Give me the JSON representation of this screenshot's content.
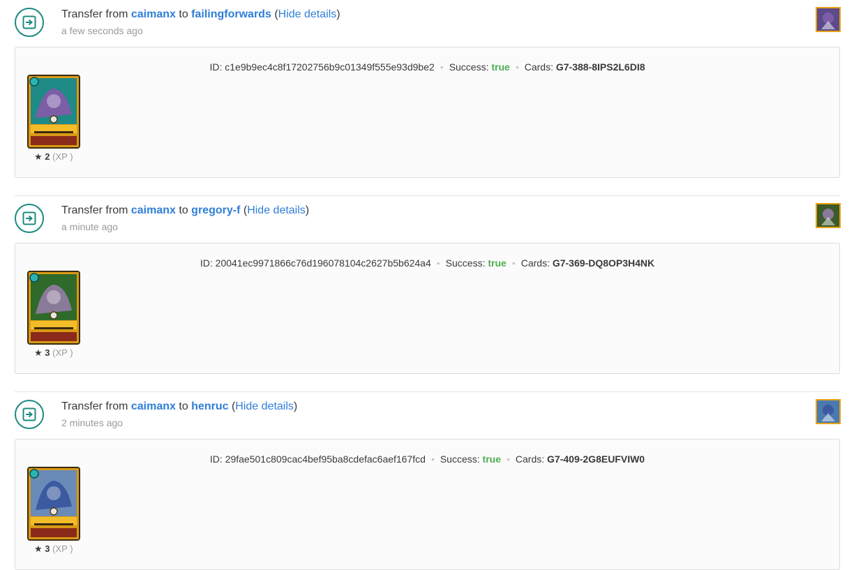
{
  "transfers": [
    {
      "prefix": "Transfer from",
      "from": "caimanx",
      "to_word": "to",
      "to": "failingforwards",
      "details_toggle": "Hide details",
      "time": "a few seconds ago",
      "id_label": "ID:",
      "id": "c1e9b9ec4c8f17202756b9c01349f555e93d9be2",
      "success_label": "Success:",
      "success": "true",
      "cards_label": "Cards:",
      "card_uid": "G7-388-8IPS2L6DI8",
      "level": "2",
      "xp_label": "(XP )",
      "theme": {
        "bg": "#1f8a86",
        "accent": "#7b5ea6",
        "thumb_bg": "#5c4a8a"
      }
    },
    {
      "prefix": "Transfer from",
      "from": "caimanx",
      "to_word": "to",
      "to": "gregory-f",
      "details_toggle": "Hide details",
      "time": "a minute ago",
      "id_label": "ID:",
      "id": "20041ec9971866c76d196078104c2627b5b624a4",
      "success_label": "Success:",
      "success": "true",
      "cards_label": "Cards:",
      "card_uid": "G7-369-DQ8OP3H4NK",
      "level": "3",
      "xp_label": "(XP )",
      "theme": {
        "bg": "#2f6a2a",
        "accent": "#8a7a9a",
        "thumb_bg": "#3d5a2a"
      }
    },
    {
      "prefix": "Transfer from",
      "from": "caimanx",
      "to_word": "to",
      "to": "henruc",
      "details_toggle": "Hide details",
      "time": "2 minutes ago",
      "id_label": "ID:",
      "id": "29fae501c809cac4bef95ba8cdefac6aef167fcd",
      "success_label": "Success:",
      "success": "true",
      "cards_label": "Cards:",
      "card_uid": "G7-409-2G8EUFVIW0",
      "level": "3",
      "xp_label": "(XP )",
      "theme": {
        "bg": "#6a8ab8",
        "accent": "#3b5aa0",
        "thumb_bg": "#4a7ab0"
      }
    }
  ],
  "colors": {
    "link": "#2f7ed8",
    "success": "#4caf50",
    "icon_teal": "#1c8a80",
    "gold": "#e8a317"
  },
  "icons": {
    "event": "transfer-arrow-icon",
    "level": "star-icon"
  }
}
